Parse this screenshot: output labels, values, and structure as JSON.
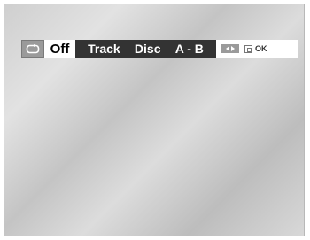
{
  "osd": {
    "repeat_icon": "repeat-icon",
    "selected_option": "Off",
    "options": [
      "Track",
      "Disc",
      "A - B"
    ],
    "help": {
      "left_right_icon": "left-right-arrows-icon",
      "enter_icon": "enter-icon",
      "ok_label": "OK"
    }
  },
  "colors": {
    "options_bar_bg": "#333333",
    "icon_bg": "#9a9a9a",
    "selected_bg": "#ffffff"
  }
}
